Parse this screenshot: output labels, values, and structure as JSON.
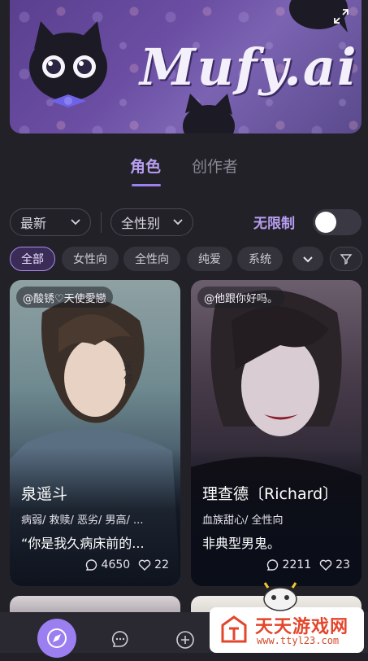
{
  "banner": {
    "logo_text": "Mufy.ai",
    "expand_icon": "expand-icon"
  },
  "tabs": [
    {
      "label": "角色",
      "active": true
    },
    {
      "label": "创作者",
      "active": false
    }
  ],
  "filters": {
    "sort": {
      "value": "最新"
    },
    "gender": {
      "value": "全性别"
    },
    "unlimited_label": "无限制",
    "unlimited_on": false
  },
  "chips": [
    {
      "label": "全部",
      "active": true
    },
    {
      "label": "女性向",
      "active": false
    },
    {
      "label": "全性向",
      "active": false
    },
    {
      "label": "纯爱",
      "active": false
    },
    {
      "label": "系统",
      "active": false
    }
  ],
  "cards": [
    {
      "creator": "@酸锈♡天使愛戀",
      "name": "泉遥斗",
      "tags": "病弱/ 救赎/ 恶劣/ 男高/ ...",
      "quote": "“你是我久病床前的...",
      "chats": "4650",
      "likes": "22"
    },
    {
      "creator": "@他跟你好吗。",
      "name": "理查德〔Richard〕",
      "tags": "血族甜心/ 全性向",
      "quote": "非典型男鬼。",
      "chats": "2211",
      "likes": "23"
    }
  ],
  "watermark": {
    "title": "天天游戏网",
    "url": "www.ttyl23.com"
  },
  "colors": {
    "accent": "#9b7ff0",
    "background": "#232128",
    "watermark_red": "#e4452b"
  }
}
